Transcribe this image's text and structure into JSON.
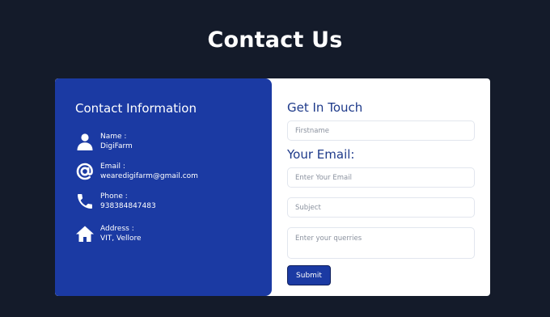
{
  "page": {
    "title": "Contact Us"
  },
  "info": {
    "heading": "Contact Information",
    "items": [
      {
        "icon": "person-icon",
        "label": "Name :",
        "value": "DigiFarm"
      },
      {
        "icon": "at-sign-icon",
        "label": "Email :",
        "value": "wearedigifarm@gmail.com"
      },
      {
        "icon": "phone-icon",
        "label": "Phone :",
        "value": "938384847483"
      },
      {
        "icon": "home-icon",
        "label": "Address :",
        "value": "VIT, Vellore"
      }
    ]
  },
  "form": {
    "heading": "Get In Touch",
    "firstname_placeholder": "Firstname",
    "email_heading": "Your Email:",
    "email_placeholder": "Enter Your Email",
    "subject_placeholder": "Subject",
    "queries_placeholder": "Enter your querries",
    "submit_label": "Submit"
  },
  "colors": {
    "background": "#141b2a",
    "panel_blue": "#1b3aa3",
    "heading_blue": "#1e3a8a",
    "card": "#ffffff"
  }
}
